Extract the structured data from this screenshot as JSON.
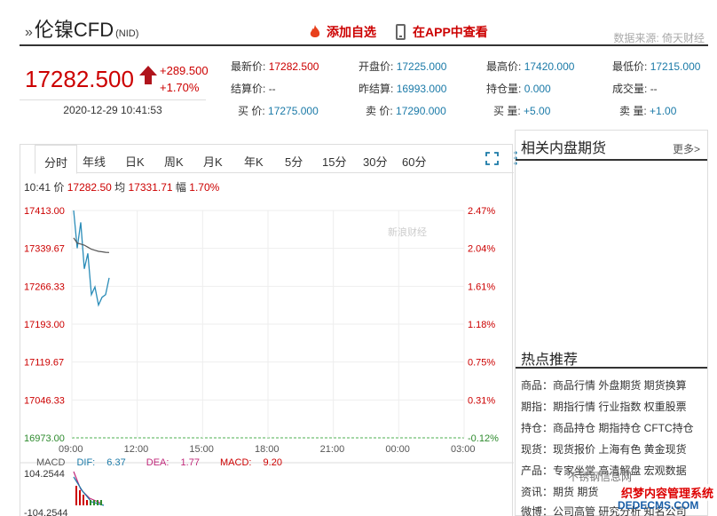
{
  "header": {
    "title": "伦镍CFD",
    "code": "(NID)",
    "add_fav": "添加自选",
    "app_view": "在APP中查看",
    "source": "数据来源: 倚天财经"
  },
  "quote": {
    "price": "17282.500",
    "change": "+289.500",
    "change_pct": "+1.70%",
    "time": "2020-12-29 10:41:53",
    "fields": {
      "latest_label": "最新价:",
      "latest": "17282.500",
      "open_label": "开盘价:",
      "open": "17225.000",
      "high_label": "最高价:",
      "high": "17420.000",
      "low_label": "最低价:",
      "low": "17215.000",
      "settle_label": "结算价:",
      "settle": "--",
      "prev_settle_label": "昨结算:",
      "prev_settle": "16993.000",
      "oi_label": "持仓量:",
      "oi": "0.000",
      "vol_label": "成交量:",
      "vol": "--",
      "bid_label": "买  价:",
      "bid": "17275.000",
      "ask_label": "卖  价:",
      "ask": "17290.000",
      "bid_vol_label": "买  量:",
      "bid_vol": "+5.00",
      "ask_vol_label": "卖  量:",
      "ask_vol": "+1.00"
    }
  },
  "tabs": [
    "分时",
    "年线",
    "日K",
    "周K",
    "月K",
    "年K",
    "5分",
    "15分",
    "30分",
    "60分"
  ],
  "chart_info": {
    "time": "10:41",
    "price_label": "价",
    "price": "17282.50",
    "avg_label": "均",
    "avg": "17331.71",
    "pct_label": "幅",
    "pct": "1.70%"
  },
  "chart_data": {
    "type": "line",
    "y_ticks": [
      "17413.00",
      "17339.67",
      "17266.33",
      "17193.00",
      "17119.67",
      "17046.33",
      "16973.00"
    ],
    "y_pct_ticks": [
      "2.47%",
      "2.04%",
      "1.61%",
      "1.18%",
      "0.75%",
      "0.31%",
      "-0.12%"
    ],
    "x_ticks": [
      "09:00",
      "12:00",
      "15:00",
      "18:00",
      "21:00",
      "00:00",
      "03:00"
    ],
    "ylim": [
      16973,
      17413
    ],
    "series": [
      {
        "values": [
          17413,
          17340,
          17390,
          17300,
          17330,
          17250,
          17265,
          17230,
          17245,
          17250,
          17282.5
        ],
        "color": "#2a8cb8"
      },
      {
        "values": [
          17360,
          17350,
          17348,
          17346,
          17342,
          17338,
          17336,
          17334,
          17333,
          17332,
          17331.71
        ],
        "color": "#555555"
      }
    ],
    "watermark": "新浪财经",
    "macd": {
      "label": "MACD",
      "dif_label": "DIF:",
      "dif": "6.37",
      "dea_label": "DEA:",
      "dea": "1.77",
      "macd_label": "MACD:",
      "macd": "9.20",
      "y_top": "104.2544",
      "y_bottom": "-104.2544"
    }
  },
  "right": {
    "related_title": "相关内盘期货",
    "more": "更多>",
    "hot_title": "热点推荐",
    "hot": [
      {
        "k": "商品：",
        "v": "商品行情 外盘期货 期货换算"
      },
      {
        "k": "期指：",
        "v": "期指行情 行业指数 权重股票"
      },
      {
        "k": "持仓：",
        "v": "商品持仓 期指持仓 CFTC持仓"
      },
      {
        "k": "现货：",
        "v": "现货报价 上海有色 黄金现货"
      },
      {
        "k": "产品：",
        "v": "专家坐堂 高清解盘 宏观数据"
      },
      {
        "k": "资讯：",
        "v": "期货  期货"
      },
      {
        "k": "微博：",
        "v": "公司高管 研究分析 知名公司"
      }
    ]
  },
  "watermarks": {
    "w1": "不锈钢信息网",
    "w2": "织梦内容管理系统",
    "w3": "DEDECMS.COM"
  }
}
